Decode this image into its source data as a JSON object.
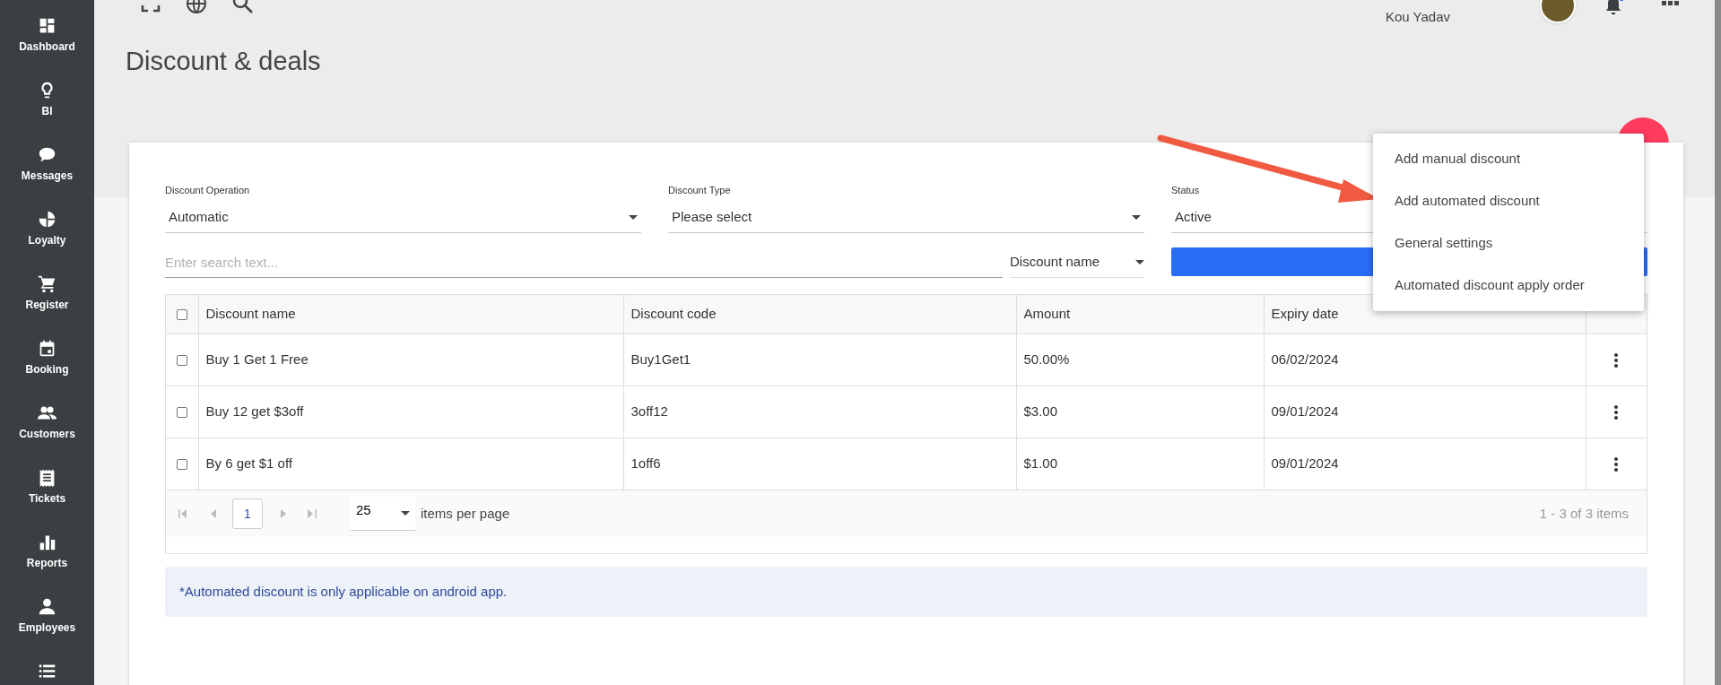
{
  "sidebar": {
    "items": [
      {
        "label": "Dashboard"
      },
      {
        "label": "BI"
      },
      {
        "label": "Messages"
      },
      {
        "label": "Loyalty"
      },
      {
        "label": "Register"
      },
      {
        "label": "Booking"
      },
      {
        "label": "Customers"
      },
      {
        "label": "Tickets"
      },
      {
        "label": "Reports"
      },
      {
        "label": "Employees"
      }
    ]
  },
  "header": {
    "user_name": "Kou Yadav"
  },
  "page_title": "Discount & deals",
  "filters": [
    {
      "label": "Discount Operation",
      "value": "Automatic"
    },
    {
      "label": "Discount Type",
      "value": "Please select"
    },
    {
      "label": "Status",
      "value": "Active"
    }
  ],
  "search": {
    "placeholder": "Enter search text...",
    "field": "Discount name"
  },
  "table": {
    "select_all_checked": false,
    "columns": [
      "Discount name",
      "Discount code",
      "Amount",
      "Expiry date"
    ],
    "rows": [
      {
        "checked": false,
        "cells": [
          "Buy 1 Get 1 Free",
          "Buy1Get1",
          "50.00%",
          "06/02/2024"
        ]
      },
      {
        "checked": false,
        "cells": [
          "Buy 12 get $3off",
          "3off12",
          "$3.00",
          "09/01/2024"
        ]
      },
      {
        "checked": false,
        "cells": [
          "By 6 get $1 off",
          "1off6",
          "$1.00",
          "09/01/2024"
        ]
      }
    ]
  },
  "pager": {
    "page": "1",
    "page_size": "25",
    "page_size_label": "items per page",
    "summary": "1 - 3 of 3 items"
  },
  "notice": "*Automated discount is only applicable on android app.",
  "menu": [
    "Add manual discount",
    "Add automated discount",
    "General settings",
    "Automated discount apply order"
  ]
}
